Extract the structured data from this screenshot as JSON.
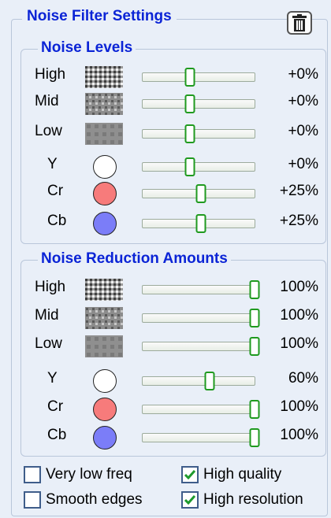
{
  "title": "Noise Filter Settings",
  "colors": {
    "accent": "#0b24d6",
    "slider": "#1f9a1f",
    "cr": "#f77b7b",
    "cb": "#7b7df8",
    "y": "#ffffff"
  },
  "noise_levels": {
    "title": "Noise Levels",
    "rows": [
      {
        "label": "High",
        "icon": "coarse-noise-swatch",
        "level": 0.42,
        "value": "+0%"
      },
      {
        "label": "Mid",
        "icon": "medium-noise-swatch",
        "level": 0.42,
        "value": "+0%"
      },
      {
        "label": "Low",
        "icon": "fine-noise-swatch",
        "level": 0.42,
        "value": "+0%"
      },
      {
        "label": "Y",
        "icon": "white-circle-icon",
        "level": 0.42,
        "value": "+0%"
      },
      {
        "label": "Cr",
        "icon": "red-circle-icon",
        "level": 0.52,
        "value": "+25%"
      },
      {
        "label": "Cb",
        "icon": "blue-circle-icon",
        "level": 0.52,
        "value": "+25%"
      }
    ]
  },
  "noise_reduction": {
    "title": "Noise Reduction Amounts",
    "rows": [
      {
        "label": "High",
        "icon": "coarse-noise-swatch",
        "level": 1.0,
        "value": "100%"
      },
      {
        "label": "Mid",
        "icon": "medium-noise-swatch",
        "level": 1.0,
        "value": "100%"
      },
      {
        "label": "Low",
        "icon": "fine-noise-swatch",
        "level": 1.0,
        "value": "100%"
      },
      {
        "label": "Y",
        "icon": "white-circle-icon",
        "level": 0.6,
        "value": "60%"
      },
      {
        "label": "Cr",
        "icon": "red-circle-icon",
        "level": 1.0,
        "value": "100%"
      },
      {
        "label": "Cb",
        "icon": "blue-circle-icon",
        "level": 1.0,
        "value": "100%"
      }
    ]
  },
  "options": [
    {
      "label": "Very low freq",
      "checked": false
    },
    {
      "label": "High quality",
      "checked": true
    },
    {
      "label": "Smooth edges",
      "checked": false
    },
    {
      "label": "High resolution",
      "checked": true
    }
  ]
}
